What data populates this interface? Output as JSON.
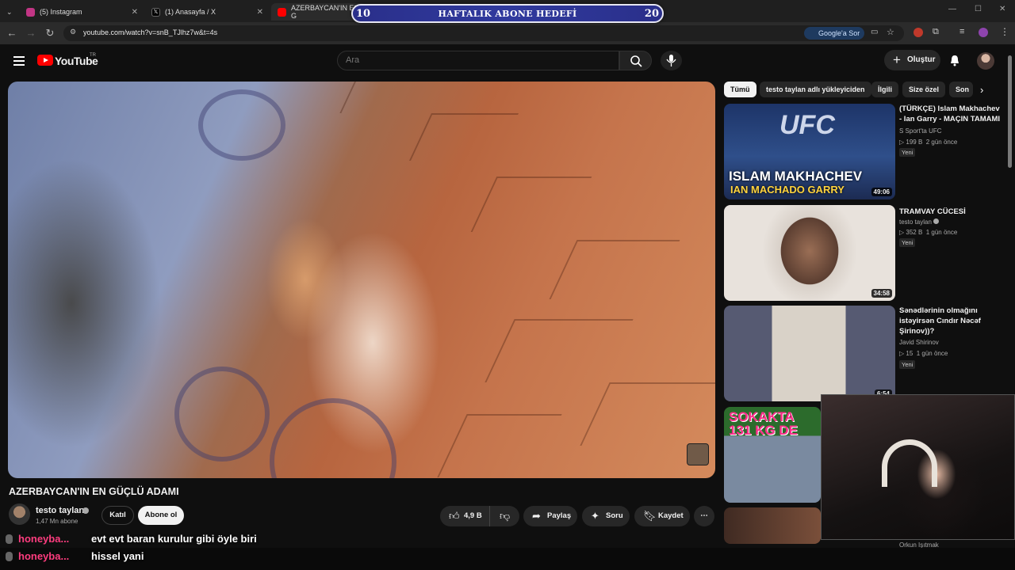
{
  "browser": {
    "tabs": [
      {
        "label": "(5) Instagram",
        "color": "#c13584"
      },
      {
        "label": "(1) Anasayfa / X",
        "color": "#000000"
      },
      {
        "label": "AZERBAYCAN'IN EN G",
        "color": "#ff0000"
      }
    ],
    "url": "youtube.com/watch?v=snB_TJlhz7w&t=4s",
    "google_ask": "Google'a Sor"
  },
  "goal": {
    "start": "10",
    "title": "HAFTALIK ABONE HEDEFİ",
    "end": "20"
  },
  "youtube": {
    "logo_text": "YouTube",
    "logo_region": "TR",
    "search_placeholder": "Ara",
    "create_label": "Oluştur"
  },
  "video": {
    "title": "AZERBAYCAN'IN EN GÜÇLÜ ADAMI",
    "channel": "testo taylan",
    "subscribers": "1,47 Mn abone",
    "join_label": "Katıl",
    "subscribe_label": "Abone ol",
    "likes": "4,9 B",
    "share_label": "Paylaş",
    "ask_label": "Soru",
    "save_label": "Kaydet"
  },
  "chat": [
    {
      "user": "honeyba...",
      "message": "evt evt baran kurulur gibi öyle biri"
    },
    {
      "user": "honeyba...",
      "message": "hissel yani"
    }
  ],
  "sidebar": {
    "chips": [
      "Tümü",
      "testo taylan adlı yükleyiciden",
      "İlgili",
      "Size özel",
      "Son"
    ],
    "recommendations": [
      {
        "title": "(TÜRKÇE) Islam Makhachev - Ian Garry - MAÇIN TAMAMI",
        "channel": "S Sport'ta UFC",
        "views": "199 B",
        "age": "2 gün önce",
        "badge": "Yeni",
        "duration": "49:06",
        "thumb_text1": "ISLAM MAKHACHEV",
        "thumb_text2": "IAN MACHADO GARRY",
        "thumb_logo": "UFC"
      },
      {
        "title": "TRAMVAY CÜCESİ",
        "channel": "testo taylan",
        "views": "352 B",
        "age": "1 gün önce",
        "badge": "Yeni",
        "duration": "34:58"
      },
      {
        "title": "Sənədlərinin olmağını istəyirsən Cındır Nəcəf Şirinov))?",
        "channel": "Javid Shirinov",
        "views": "15",
        "age": "1 gün önce",
        "badge": "Yeni",
        "duration": "6:54"
      },
      {
        "thumb_text": "SOKAKTA 131 KG DE"
      },
      {
        "channel": "Orkun Işıtmak"
      }
    ]
  }
}
